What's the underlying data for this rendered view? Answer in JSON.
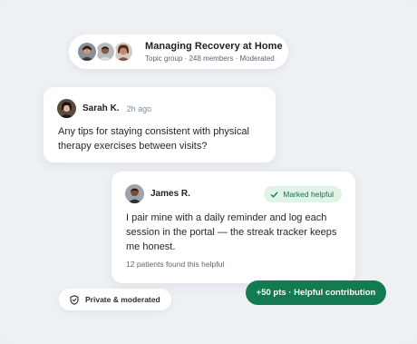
{
  "group": {
    "title": "Managing Recovery at Home",
    "meta": "Topic group · 248 members · Moderated",
    "avatars": [
      "member-avatar-1",
      "member-avatar-2",
      "member-avatar-3"
    ]
  },
  "question": {
    "author": "Sarah K.",
    "time": "2h ago",
    "body": "Any tips for staying consistent with physical therapy exercises between visits?"
  },
  "answer": {
    "author": "James R.",
    "badge": "Marked helpful",
    "body": "I pair mine with a daily reminder and log each session in the portal — the streak tracker keeps me honest.",
    "helpful_count": "12 patients found this helpful"
  },
  "footer": {
    "privacy": "Private & moderated",
    "points": "+50 pts · Helpful contribution"
  },
  "colors": {
    "background": "#eef1f4",
    "accent": "#137a52",
    "badge_bg": "#e1f3e7",
    "badge_text": "#17704a"
  }
}
